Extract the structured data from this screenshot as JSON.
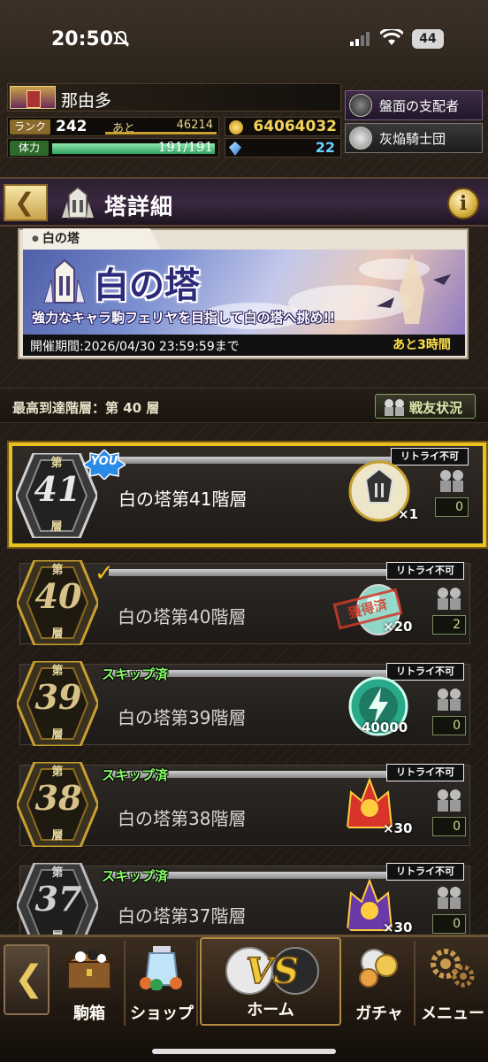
{
  "status_bar": {
    "time": "20:50",
    "battery": "44"
  },
  "player": {
    "name": "那由多",
    "rank_label": "ランク",
    "rank": "242",
    "next_label": "あと",
    "next_exp": "46214",
    "stamina_label": "体力",
    "stamina_text": "191/191",
    "stamina_fraction": 1.0,
    "gold": "64064032",
    "gems": "22"
  },
  "titles": {
    "title_1": "盤面の支配者",
    "title_2": "灰焔騎士団"
  },
  "header": {
    "title": "塔詳細",
    "info_label": "i"
  },
  "banner": {
    "tab_label": "白の塔",
    "title": "白の塔",
    "subtitle": "強力なキャラ駒フェリヤを目指して白の塔へ挑め!!",
    "period": "開催期間:2026/04/30 23:59:59まで",
    "remaining": "あと3時間"
  },
  "progress": {
    "highest_floor": "最高到達階層：第 40 層",
    "allies_button": "戦友状況"
  },
  "floor_labels": {
    "dai": "第",
    "sou": "層",
    "you": "YOU",
    "skip": "スキップ済",
    "stamp": "獲得済"
  },
  "floors": [
    {
      "number": "41",
      "title": "白の塔第41階層",
      "retry": "リトライ不可",
      "reward_count": "×1",
      "allies": "0"
    },
    {
      "number": "40",
      "title": "白の塔第40階層",
      "retry": "リトライ不可",
      "reward_count": "×20",
      "allies": "2"
    },
    {
      "number": "39",
      "title": "白の塔第39階層",
      "retry": "リトライ不可",
      "reward_count": "40000",
      "allies": "0"
    },
    {
      "number": "38",
      "title": "白の塔第38階層",
      "retry": "リトライ不可",
      "reward_count": "×30",
      "allies": "0"
    },
    {
      "number": "37",
      "title": "白の塔第37階層",
      "retry": "リトライ不可",
      "reward_count": "×30",
      "allies": "0"
    }
  ],
  "nav": {
    "komabako": "駒箱",
    "shop": "ショップ",
    "home": "ホーム",
    "home_badge": "VS",
    "gacha": "ガチャ",
    "menu": "メニュー"
  },
  "colors": {
    "accent_gold": "#e8c020",
    "skip_green": "#8aff6a",
    "stamp_red": "#d03a2a"
  }
}
